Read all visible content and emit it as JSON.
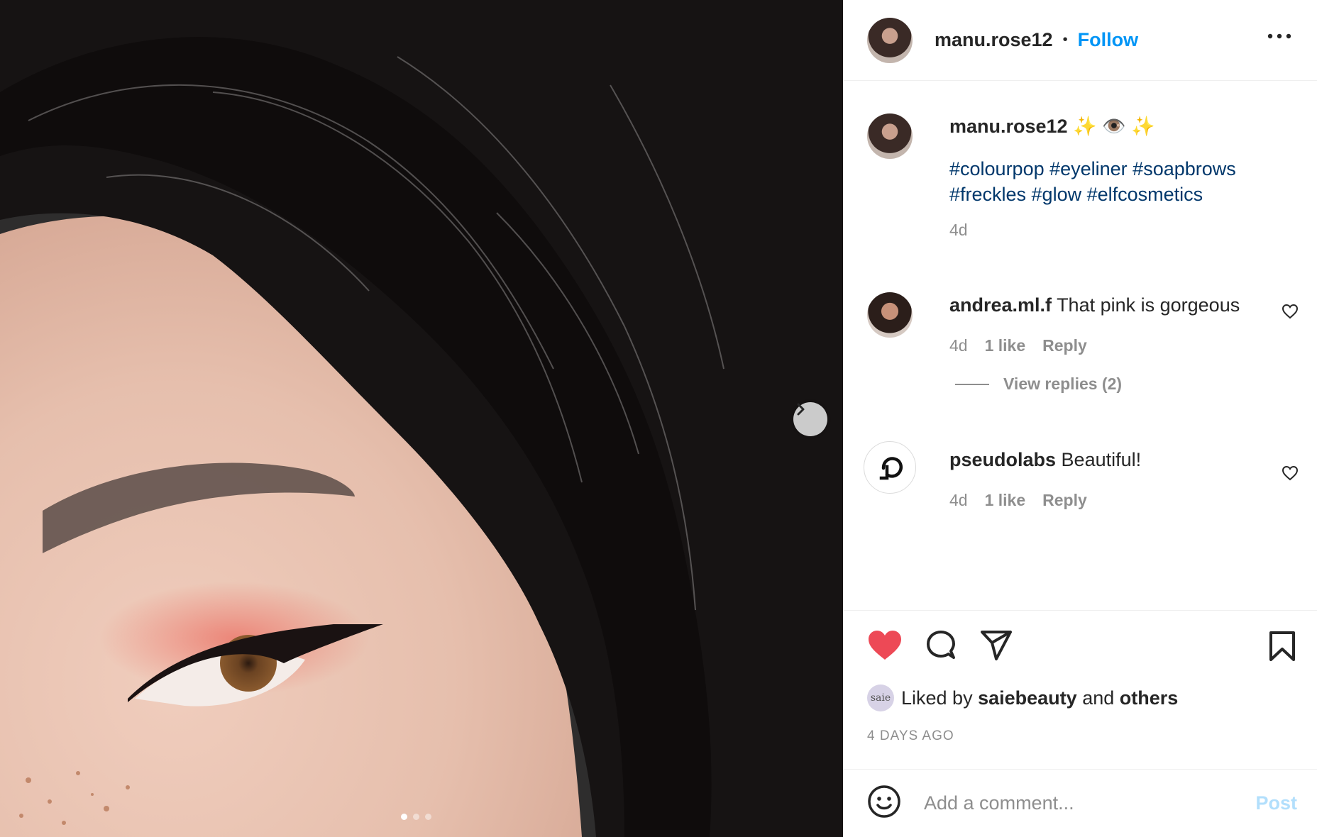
{
  "post": {
    "author": "manu.rose12",
    "follow_label": "Follow",
    "bullet": "•",
    "caption_emoji": "✨ 👁️ ✨",
    "hashtags_line1": "#colourpop #eyeliner #soapbrows",
    "hashtags_line2": "#freckles #glow #elfcosmetics",
    "caption_time": "4d"
  },
  "carousel": {
    "slide_count": 3,
    "active_slide": 1
  },
  "comments": [
    {
      "user": "andrea.ml.f",
      "text": "That pink is gorgeous",
      "time": "4d",
      "likes": "1 like",
      "reply": "Reply",
      "view_replies": "View replies (2)"
    },
    {
      "user": "pseudolabs",
      "text": "Beautiful!",
      "time": "4d",
      "likes": "1 like",
      "reply": "Reply"
    }
  ],
  "likes": {
    "avatar_text": "saie",
    "prefix": "Liked by",
    "user": "saiebeauty",
    "joiner": "and",
    "others": "others"
  },
  "date_label": "4 DAYS AGO",
  "add_comment": {
    "placeholder": "Add a comment...",
    "post_label": "Post"
  },
  "colors": {
    "accent": "#0095f6",
    "like_red": "#ed4956",
    "hashtag": "#00376b",
    "muted": "#8e8e8e"
  }
}
